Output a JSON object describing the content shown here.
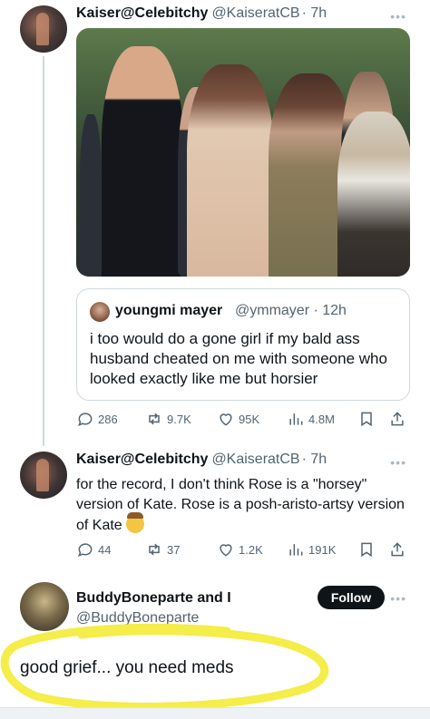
{
  "tweet1": {
    "name": "Kaiser@Celebitchy",
    "handle": "@KaiseratCB",
    "time": "· 7h",
    "more": "•••",
    "quote": {
      "name": "youngmi mayer",
      "handle": "@ymmayer · 12h",
      "text": "i too would do a gone girl if my bald ass husband cheated on me with someone who looked exactly like me but horsier"
    },
    "actions": {
      "replies": "286",
      "reposts": "9.7K",
      "likes": "95K",
      "views": "4.8M"
    }
  },
  "tweet2": {
    "name": "Kaiser@Celebitchy",
    "handle": "@KaiseratCB",
    "time": "· 7h",
    "more": "•••",
    "text": "for the record, I don't think Rose is a \"horsey\" version of Kate.  Rose is a posh-aristo-artsy version of Kate",
    "actions": {
      "replies": "44",
      "reposts": "37",
      "likes": "1.2K",
      "views": "191K"
    }
  },
  "reply": {
    "name": "BuddyBoneparte and I",
    "handle": "@BuddyBoneparte",
    "follow_label": "Follow",
    "more": "•••",
    "text": "good grief... you need meds"
  },
  "icons": {
    "reply": "reply-icon",
    "repost": "repost-icon",
    "like": "heart-icon",
    "views": "views-icon",
    "bookmark": "bookmark-icon",
    "share": "share-icon"
  },
  "colors": {
    "text": "#0f1419",
    "muted": "#536471",
    "border": "#cfd9de",
    "highlight": "#f4ec3a",
    "follow_bg": "#0f1419"
  }
}
